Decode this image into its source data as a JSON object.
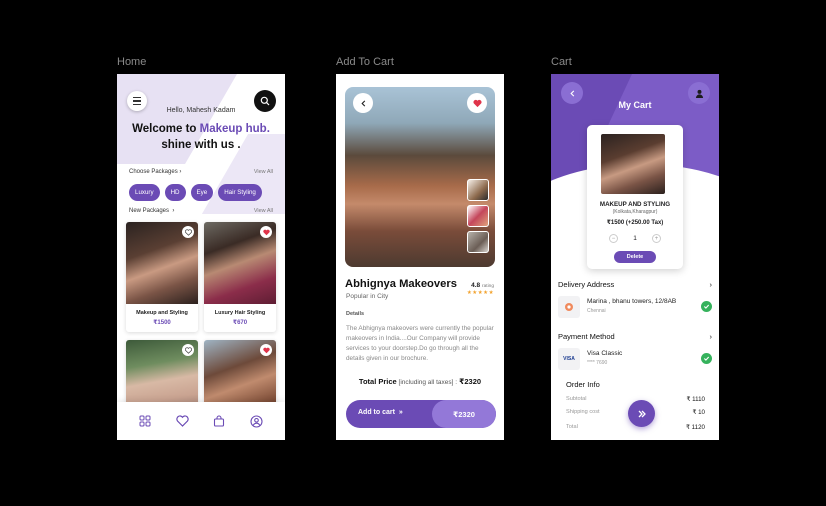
{
  "labels": {
    "home": "Home",
    "add_to_cart": "Add To Cart",
    "cart": "Cart"
  },
  "home": {
    "greeting": "Hello,  Mahesh Kadam",
    "welcome_prefix": "Welcome to ",
    "welcome_accent": "Makeup hub.",
    "welcome_line2": "shine with us .",
    "packages_title": "Choose Packages",
    "view_all": "View All",
    "chips": [
      "Luxury",
      "HD",
      "Eye",
      "Hair Styling"
    ],
    "new_packages_title": "New Packages",
    "cards": [
      {
        "title": "Makeup and Styling",
        "price": "₹1500"
      },
      {
        "title": "Luxury Hair Styling",
        "price": "₹670"
      }
    ]
  },
  "product": {
    "title": "Abhignya Makeovers",
    "subtitle": "Popular in City",
    "rating_value": "4.8",
    "rating_label": "rating",
    "stars": "★★★★★",
    "details_title": "Details",
    "details_text": "The Abhignya makeovers were currently the popular makeovers in India....Our Company will provide services to your doorstep.Do go through all the details given in our brochure.",
    "total_label": "Total Price",
    "total_tax_note": " [including all taxes] :",
    "total_value": "₹2320",
    "add_to_cart_label": "Add to cart",
    "cart_price": "₹2320"
  },
  "cart": {
    "title": "My Cart",
    "item_name": "MAKEUP AND STYLING",
    "item_location": "(Kolkata,Kharagpur)",
    "item_price": "₹1500 (+250.00 Tax)",
    "quantity": "1",
    "delete_label": "Delete",
    "delivery_title": "Delivery Address",
    "address_line1": "Marina , bhanu towers, 12/8AB",
    "address_city": "Chennai",
    "payment_title": "Payment Method",
    "card_name": "Visa Classic",
    "card_number": "**** 7690",
    "visa_badge": "VISA",
    "order_title": "Order Info",
    "order_rows": [
      {
        "label": "Subtotal",
        "value": "₹ 1110"
      },
      {
        "label": "Shipping cost",
        "value": "₹ 10"
      },
      {
        "label": "Total",
        "value": "₹ 1120"
      }
    ]
  },
  "colors": {
    "accent": "#6b4bb5",
    "accent_light": "#9378d8",
    "success": "#35b25c",
    "star": "#f2a32f"
  }
}
